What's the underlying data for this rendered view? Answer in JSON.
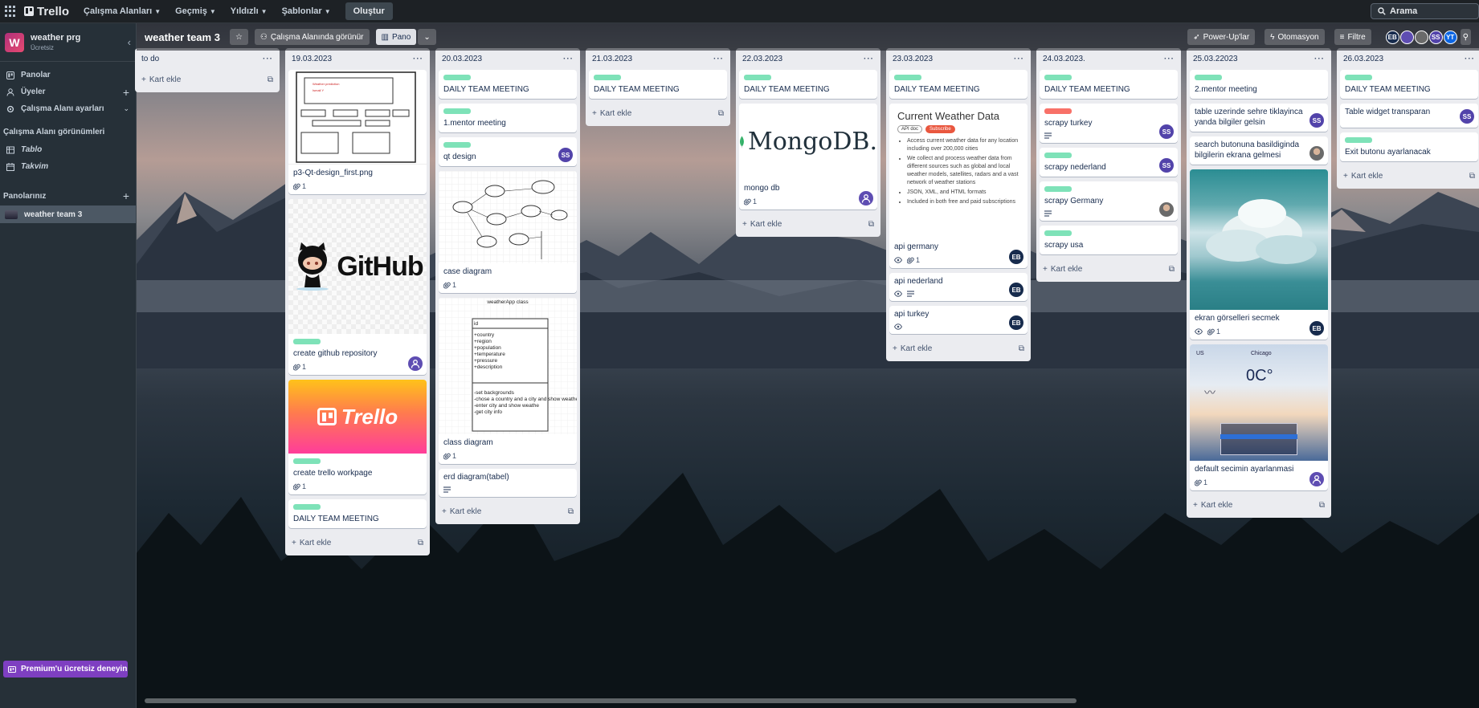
{
  "topbar": {
    "app_name": "Trello",
    "menus": [
      {
        "label": "Çalışma Alanları"
      },
      {
        "label": "Geçmiş"
      },
      {
        "label": "Yıldızlı"
      },
      {
        "label": "Şablonlar"
      }
    ],
    "create_label": "Oluştur",
    "search_placeholder": "Arama"
  },
  "sidebar": {
    "workspace_initial": "W",
    "workspace_name": "weather prg",
    "workspace_plan": "Ücretsiz",
    "items": [
      {
        "label": "Panolar",
        "icon": "board-icon"
      },
      {
        "label": "Üyeler",
        "icon": "person-icon"
      },
      {
        "label": "Çalışma Alanı ayarları",
        "icon": "gear-icon"
      }
    ],
    "views_heading": "Çalışma Alanı görünümleri",
    "views": [
      {
        "label": "Tablo",
        "icon": "table-icon"
      },
      {
        "label": "Takvim",
        "icon": "calendar-icon"
      }
    ],
    "boards_heading": "Panolarınız",
    "boards": [
      {
        "label": "weather team 3"
      }
    ],
    "premium_label": "Premium'u ücretsiz deneyin"
  },
  "board": {
    "title": "weather team 3",
    "visibility_label": "Çalışma Alanında görünür",
    "view_label": "Pano",
    "powerups_label": "Power-Up'lar",
    "automation_label": "Otomasyon",
    "filter_label": "Filtre",
    "members": [
      {
        "initials": "EB",
        "color": "#172b4d"
      },
      {
        "initials": "",
        "color": "#5e4db2"
      },
      {
        "initials": "",
        "color": "#6a6a6a"
      },
      {
        "initials": "SS",
        "color": "#5243aa"
      },
      {
        "initials": "YT",
        "color": "#0c66e4"
      }
    ],
    "add_card_label": "Kart ekle"
  },
  "lists": [
    {
      "title": "to do",
      "cards": []
    },
    {
      "title": "19.03.2023",
      "cards": [
        {
          "title": "p3-Qt-design_first.png",
          "cover": "wireframe",
          "attachments": "1"
        },
        {
          "title": "create github repository",
          "cover": "github",
          "cover_text": "GitHub",
          "label": "green",
          "attachments": "1",
          "member": "user"
        },
        {
          "title": "create trello workpage",
          "cover": "trello",
          "cover_text": "Trello",
          "label": "green",
          "attachments": "1"
        },
        {
          "title": "DAILY TEAM MEETING",
          "label": "green"
        }
      ]
    },
    {
      "title": "20.03.2023",
      "cards": [
        {
          "title": "DAILY TEAM MEETING",
          "label": "green"
        },
        {
          "title": "1.mentor meeting",
          "label": "green"
        },
        {
          "title": "qt design",
          "label": "green",
          "member": "SS"
        },
        {
          "title": "case diagram",
          "cover": "case",
          "attachments": "1"
        },
        {
          "title": "class diagram",
          "cover": "class",
          "attachments": "1"
        },
        {
          "title": "erd diagram(tabel)",
          "description": true
        }
      ]
    },
    {
      "title": "21.03.2023",
      "cards": [
        {
          "title": "DAILY TEAM MEETING",
          "label": "green"
        }
      ]
    },
    {
      "title": "22.03.2023",
      "cards": [
        {
          "title": "DAILY TEAM MEETING",
          "label": "green"
        },
        {
          "title": "mongo db",
          "cover": "mongo",
          "cover_text": "MongoDB.",
          "attachments": "1",
          "member": "user"
        }
      ]
    },
    {
      "title": "23.03.2023",
      "cards": [
        {
          "title": "DAILY TEAM MEETING",
          "label": "green"
        },
        {
          "title": "api germany",
          "cover": "weather",
          "watch": true,
          "attachments": "1",
          "member": "EB"
        },
        {
          "title": "api nederland",
          "watch": true,
          "description": true,
          "member": "EB"
        },
        {
          "title": "api turkey",
          "watch": true,
          "member": "EB"
        }
      ]
    },
    {
      "title": "24.03.2023.",
      "cards": [
        {
          "title": "DAILY TEAM MEETING",
          "label": "green"
        },
        {
          "title": "scrapy turkey",
          "label": "red",
          "description": true,
          "member": "SS"
        },
        {
          "title": "scrapy nederland",
          "label": "green",
          "member": "SS"
        },
        {
          "title": "scrapy Germany",
          "label": "green",
          "description": true,
          "member": "photo"
        },
        {
          "title": "scrapy usa",
          "label": "green"
        }
      ]
    },
    {
      "title": "25.03.22023",
      "cards": [
        {
          "title": "2.mentor meeting",
          "label": "green"
        },
        {
          "title": "table uzerinde sehre tiklayinca yanda bilgiler gelsin",
          "member": "SS"
        },
        {
          "title": "search butonuna basildiginda bilgilerin ekrana gelmesi",
          "member": "photo"
        },
        {
          "title": "ekran görselleri secmek",
          "cover": "sky",
          "watch": true,
          "attachments": "1",
          "member": "EB"
        },
        {
          "title": "default secimin ayarlanmasi",
          "cover": "app",
          "cover_text": "0C°",
          "cover_city": "Chicago",
          "cover_country": "US",
          "attachments": "1",
          "member": "user"
        }
      ]
    },
    {
      "title": "26.03.2023",
      "cards": [
        {
          "title": "DAILY TEAM MEETING",
          "label": "green"
        },
        {
          "title": "Table widget transparan",
          "member": "SS"
        },
        {
          "title": "Exit butonu ayarlanacak",
          "label": "green"
        }
      ]
    }
  ],
  "covers": {
    "wireframe": {
      "title": "Weather prediction",
      "subtitle": "Ismail Y"
    },
    "class_diagram": {
      "title": "weatherApp class",
      "field": "id",
      "attributes": [
        "+country",
        "+region",
        "+population",
        "+temperature",
        "+pressure",
        "+description"
      ],
      "methods": [
        "-set backgrounds",
        "-chose a country and a city and show weather",
        "-enter city and show weathe",
        "-get city info"
      ]
    },
    "weather_api": {
      "title": "Current Weather Data",
      "tags": [
        "API doc",
        "Subscribe"
      ],
      "bullets": [
        "Access current weather data for any location including over 200,000 cities",
        "We collect and process weather data from different sources such as global and local weather models, satellites, radars and a vast network of weather stations",
        "JSON, XML, and HTML formats",
        "Included in both free and paid subscriptions"
      ]
    }
  }
}
